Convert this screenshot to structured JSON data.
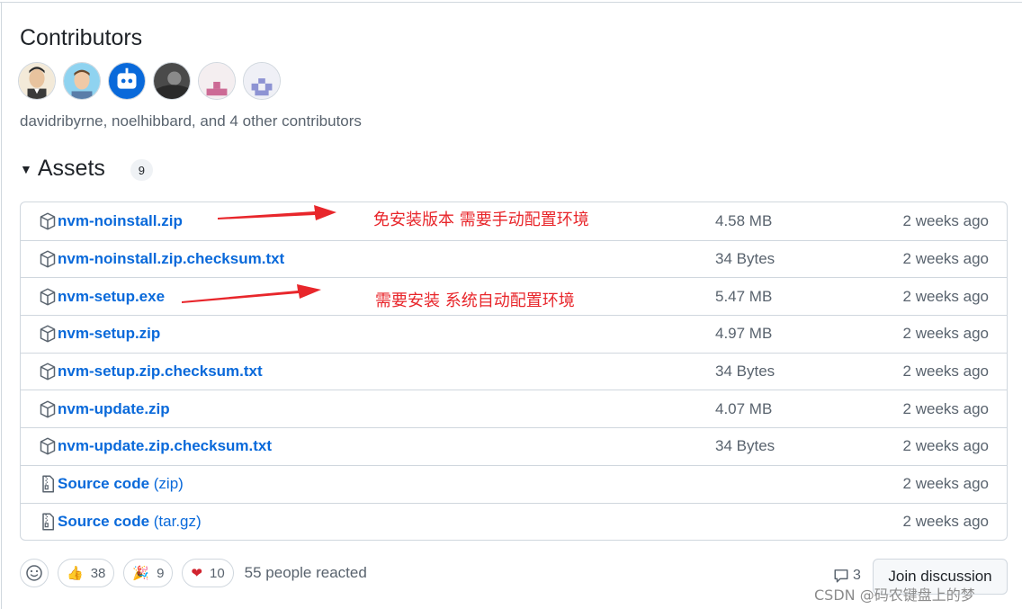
{
  "contributors": {
    "title": "Contributors",
    "summary": "davidribyrne, noelhibbard, and 4 other contributors",
    "avatars": [
      "avatar-cartoon",
      "avatar-photo",
      "avatar-bot",
      "avatar-dark",
      "avatar-identicon-pink",
      "avatar-identicon-purple"
    ]
  },
  "assets": {
    "title": "Assets",
    "count": "9",
    "rows": [
      {
        "name": "nvm-noinstall.zip",
        "suffix": "",
        "size": "4.58 MB",
        "time": "2 weeks ago",
        "icon": "package-icon"
      },
      {
        "name": "nvm-noinstall.zip.checksum.txt",
        "suffix": "",
        "size": "34 Bytes",
        "time": "2 weeks ago",
        "icon": "package-icon"
      },
      {
        "name": "nvm-setup.exe",
        "suffix": "",
        "size": "5.47 MB",
        "time": "2 weeks ago",
        "icon": "package-icon"
      },
      {
        "name": "nvm-setup.zip",
        "suffix": "",
        "size": "4.97 MB",
        "time": "2 weeks ago",
        "icon": "package-icon"
      },
      {
        "name": "nvm-setup.zip.checksum.txt",
        "suffix": "",
        "size": "34 Bytes",
        "time": "2 weeks ago",
        "icon": "package-icon"
      },
      {
        "name": "nvm-update.zip",
        "suffix": "",
        "size": "4.07 MB",
        "time": "2 weeks ago",
        "icon": "package-icon"
      },
      {
        "name": "nvm-update.zip.checksum.txt",
        "suffix": "",
        "size": "34 Bytes",
        "time": "2 weeks ago",
        "icon": "package-icon"
      },
      {
        "name": "Source code",
        "suffix": " (zip)",
        "size": "",
        "time": "2 weeks ago",
        "icon": "file-zip-icon"
      },
      {
        "name": "Source code",
        "suffix": " (tar.gz)",
        "size": "",
        "time": "2 weeks ago",
        "icon": "file-zip-icon"
      }
    ]
  },
  "annotations": {
    "noinstall": "免安装版本 需要手动配置环境",
    "setup": "需要安装 系统自动配置环境",
    "color": "#e8262b"
  },
  "reactions": {
    "thumbs_up": {
      "emoji": "👍",
      "count": "38"
    },
    "tada": {
      "emoji": "🎉",
      "count": "9"
    },
    "heart": {
      "emoji": "❤",
      "count": "10"
    },
    "summary": "55 people reacted"
  },
  "discussion": {
    "comment_count": "3",
    "join_label": "Join discussion"
  },
  "watermark": "CSDN @码农键盘上的梦"
}
